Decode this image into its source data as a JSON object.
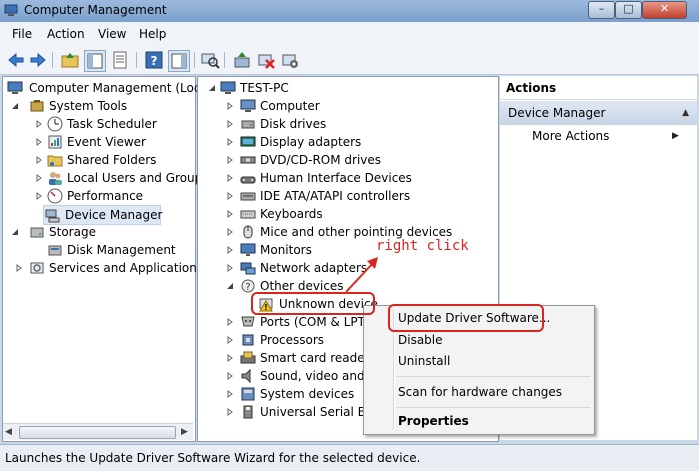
{
  "window": {
    "title": "Computer Management"
  },
  "menu": [
    "File",
    "Action",
    "View",
    "Help"
  ],
  "left_tree": {
    "root": "Computer Management (Local",
    "system_tools": "System Tools",
    "items": [
      "Task Scheduler",
      "Event Viewer",
      "Shared Folders",
      "Local Users and Groups",
      "Performance",
      "Device Manager"
    ],
    "storage": "Storage",
    "disk_management": "Disk Management",
    "services": "Services and Applications"
  },
  "device_tree": {
    "root": "TEST-PC",
    "categories": [
      "Computer",
      "Disk drives",
      "Display adapters",
      "DVD/CD-ROM drives",
      "Human Interface Devices",
      "IDE ATA/ATAPI controllers",
      "Keyboards",
      "Mice and other pointing devices",
      "Monitors",
      "Network adapters",
      "Other devices"
    ],
    "unknown_device": "Unknown device",
    "after": [
      "Ports (COM & LPT)",
      "Processors",
      "Smart card readers",
      "Sound, video and g",
      "System devices",
      "Universal Serial Bus"
    ]
  },
  "actions": {
    "title": "Actions",
    "section": "Device Manager",
    "more": "More Actions"
  },
  "context_menu": {
    "update": "Update Driver Software...",
    "disable": "Disable",
    "uninstall": "Uninstall",
    "scan": "Scan for hardware changes",
    "properties": "Properties"
  },
  "annotation": "right click",
  "status": "Launches the Update Driver Software Wizard for the selected device.",
  "colors": {
    "annotation_red": "#d7261f",
    "selected_bg": "#dde8f5"
  }
}
